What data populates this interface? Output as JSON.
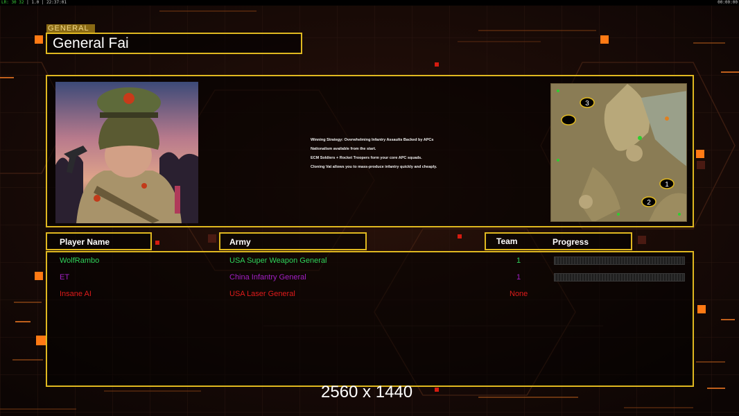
{
  "top_bar": {
    "left_green": "LR: 30 32",
    "left_mid": "| 1.0 |",
    "clock": "22:37:01",
    "right_timer": "00:00:00"
  },
  "general": {
    "label": "GENERAL",
    "name": "General Fai"
  },
  "strategy": {
    "lines": [
      "Winning Strategy: Overwhelming Infantry Assaults Backed by APCs",
      "Nationalism available from the start.",
      "ECM Soldiers + Rocket Troopers form your core APC squads.",
      "Cloning Vat allows you to mass-produce infantry quickly and cheaply."
    ]
  },
  "minimap": {
    "start_positions": [
      "3",
      "1",
      "2"
    ]
  },
  "headers": {
    "player_name": "Player Name",
    "army": "Army",
    "team": "Team",
    "progress": "Progress"
  },
  "players": [
    {
      "name": "WolfRambo",
      "army": "USA Super Weapon General",
      "team": "1",
      "color": "#2fd45a",
      "progress": 0
    },
    {
      "name": "ET",
      "army": "China Infantry General",
      "team": "1",
      "color": "#a21fc4",
      "progress": 0
    },
    {
      "name": "Insane AI",
      "army": "USA Laser General",
      "team": "None",
      "color": "#e01b1b"
    }
  ],
  "resolution_label": "2560 x 1440",
  "colors": {
    "accent": "#e0b820",
    "background": "#120806",
    "orange_square": "#ff7a14"
  }
}
